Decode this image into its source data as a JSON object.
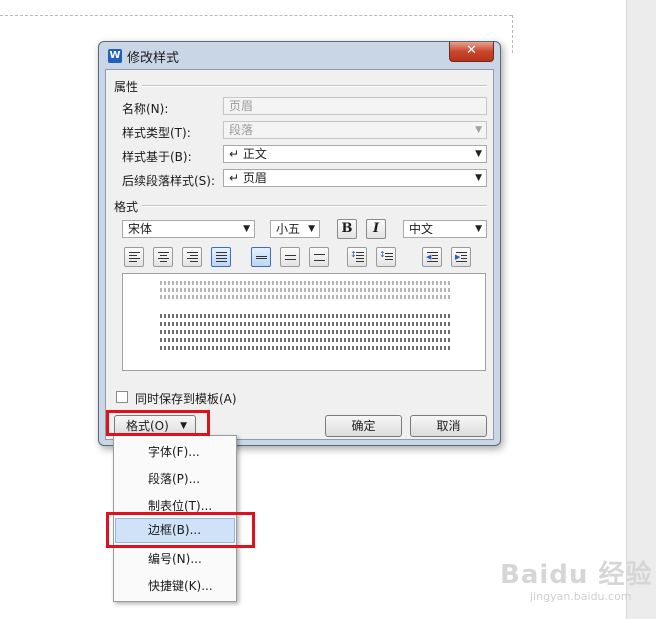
{
  "dialog": {
    "title": "修改样式",
    "app_icon_letter": "W",
    "close_glyph": "✕",
    "properties_label": "属性",
    "name_label": "名称(N):",
    "name_value": "页眉",
    "style_type_label": "样式类型(T):",
    "style_type_value": "段落",
    "based_on_label": "样式基于(B):",
    "based_on_value": "↵ 正文",
    "following_label": "后续段落样式(S):",
    "following_value": "↵ 页眉",
    "format_label": "格式",
    "font_name": "宋体",
    "font_size": "小五",
    "bold_label": "B",
    "italic_label": "I",
    "script": "中文",
    "save_template_label": "同时保存到模板(A)",
    "format_button": "格式(O)",
    "ok_button": "确定",
    "cancel_button": "取消"
  },
  "format_menu": {
    "items": [
      "字体(F)...",
      "段落(P)...",
      "制表位(T)...",
      "边框(B)...",
      "编号(N)...",
      "快捷键(K)..."
    ]
  },
  "watermark": {
    "logo": "Baidu 经验",
    "url": "jingyan.baidu.com"
  },
  "colors": {
    "dialog_frame": "#c9d6e6",
    "close_button": "#c9462c",
    "highlight": "#e0101c",
    "menu_hover": "#cfe2f7"
  }
}
